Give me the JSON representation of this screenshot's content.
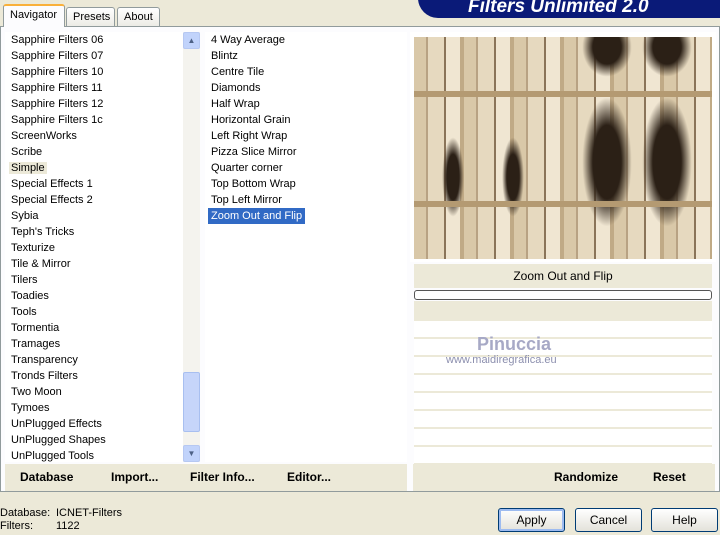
{
  "tabs": [
    "Navigator",
    "Presets",
    "About"
  ],
  "banner_title": "Filters Unlimited 2.0",
  "categories": [
    "Sapphire Filters 06",
    "Sapphire Filters 07",
    "Sapphire Filters 10",
    "Sapphire Filters 11",
    "Sapphire Filters 12",
    "Sapphire Filters 1c",
    "ScreenWorks",
    "Scribe",
    "Simple",
    "Special Effects 1",
    "Special Effects 2",
    "Sybia",
    "Teph's Tricks",
    "Texturize",
    "Tile & Mirror",
    "Tilers",
    "Toadies",
    "Tools",
    "Tormentia",
    "Tramages",
    "Transparency",
    "Tronds Filters",
    "Two Moon",
    "Tymoes",
    "UnPlugged Effects",
    "UnPlugged Shapes",
    "UnPlugged Tools"
  ],
  "selected_category": "Simple",
  "filters": [
    "4 Way Average",
    "Blintz",
    "Centre Tile",
    "Diamonds",
    "Half Wrap",
    "Horizontal Grain",
    "Left Right Wrap",
    "Pizza Slice Mirror",
    "Quarter corner",
    "Top Bottom Wrap",
    "Top Left Mirror",
    "Zoom Out and Flip"
  ],
  "selected_filter": "Zoom Out and Flip",
  "preview_label": "Zoom Out and Flip",
  "progress": 0,
  "watermark": {
    "name": "Pinuccia",
    "url": "www.maidiregrafica.eu"
  },
  "left_buttons": {
    "database": "Database",
    "import": "Import...",
    "filter_info": "Filter Info...",
    "editor": "Editor..."
  },
  "right_buttons": {
    "randomize": "Randomize",
    "reset": "Reset"
  },
  "status": {
    "database_label": "Database:",
    "database_value": "ICNET-Filters",
    "filters_label": "Filters:",
    "filters_value": "1122"
  },
  "dialog_buttons": {
    "apply": "Apply",
    "cancel": "Cancel",
    "help": "Help"
  }
}
